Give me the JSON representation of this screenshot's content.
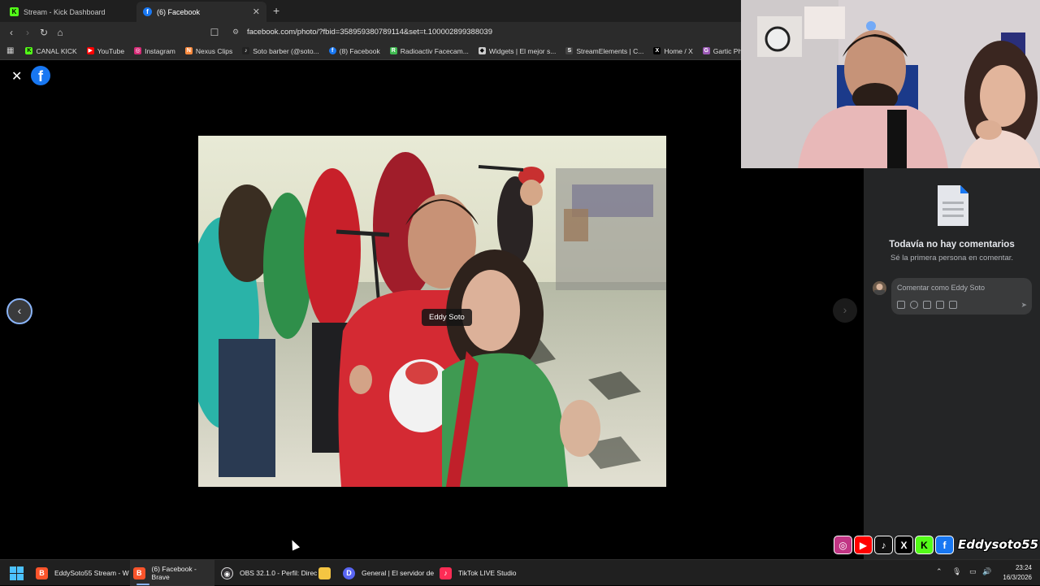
{
  "browser": {
    "tabs": [
      {
        "label": "Stream - Kick Dashboard",
        "icon": "kick-icon",
        "color": "#53fc18"
      },
      {
        "label": "(6) Facebook",
        "icon": "facebook-icon",
        "color": "#1877f2"
      }
    ],
    "url": "facebook.com/photo/?fbid=358959380789114&set=t.100002899388039",
    "bookmarks": [
      {
        "label": "CANAL KICK",
        "icon": "kick-icon",
        "color": "#53fc18"
      },
      {
        "label": "YouTube",
        "icon": "youtube-icon",
        "color": "#ff0000"
      },
      {
        "label": "Instagram",
        "icon": "instagram-icon",
        "color": "#d62976"
      },
      {
        "label": "Nexus Clips",
        "icon": "nexus-icon",
        "color": "#ff8a3d"
      },
      {
        "label": "Soto barber (@soto...",
        "icon": "tiktok-icon",
        "color": "#222222"
      },
      {
        "label": "(8) Facebook",
        "icon": "facebook-icon",
        "color": "#1877f2"
      },
      {
        "label": "Radioactiv Facecam...",
        "icon": "radioactiv-icon",
        "color": "#3fb950"
      },
      {
        "label": "Widgets | El mejor s...",
        "icon": "widgets-icon",
        "color": "#cccccc"
      },
      {
        "label": "StreamElements | C...",
        "icon": "streamelements-icon",
        "color": "#444444"
      },
      {
        "label": "Home / X",
        "icon": "x-icon",
        "color": "#000000"
      },
      {
        "label": "Gartic Phone - Tele",
        "icon": "gartic-icon",
        "color": "#9b59b6"
      }
    ]
  },
  "viewer": {
    "tag_label": "Eddy Soto"
  },
  "comments": {
    "empty_title": "Todavía no hay comentarios",
    "empty_subtitle": "Sé la primera persona en comentar.",
    "placeholder": "Comentar como Eddy Soto"
  },
  "overlay": {
    "handle": "Eddysoto55",
    "socials": [
      {
        "icon": "instagram-icon",
        "glyph": "◎",
        "color": "#c13584"
      },
      {
        "icon": "youtube-icon",
        "glyph": "▶",
        "color": "#ff0000"
      },
      {
        "icon": "tiktok-icon",
        "glyph": "♪",
        "color": "#111111"
      },
      {
        "icon": "x-icon",
        "glyph": "X",
        "color": "#000000"
      },
      {
        "icon": "kick-icon",
        "glyph": "K",
        "color": "#53fc18"
      },
      {
        "icon": "facebook-icon",
        "glyph": "f",
        "color": "#1877f2"
      }
    ]
  },
  "taskbar": {
    "items": [
      {
        "label": "EddySoto55 Stream - W",
        "icon": "brave-icon",
        "color": "#fb542b"
      },
      {
        "label": "(6) Facebook - Brave",
        "icon": "brave-icon",
        "color": "#fb542b"
      },
      {
        "label": "OBS 32.1.0 - Perfil: Direc",
        "icon": "obs-icon",
        "color": "#302e31"
      },
      {
        "label": "",
        "icon": "folder-icon",
        "color": "#f4c542"
      },
      {
        "label": "General | El servidor de",
        "icon": "discord-icon",
        "color": "#5865f2"
      },
      {
        "label": "TikTok LIVE Studio",
        "icon": "tiktok-live-icon",
        "color": "#fe2c55"
      }
    ],
    "time": "23:24",
    "date": "16/3/2026"
  }
}
